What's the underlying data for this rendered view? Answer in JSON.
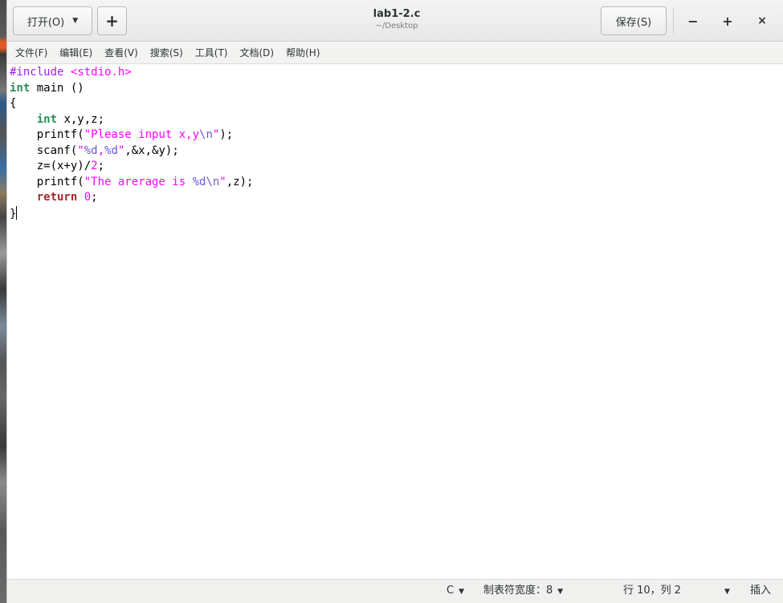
{
  "header": {
    "open_label": "打开(O)",
    "new_label": "+",
    "title": "lab1-2.c",
    "subtitle": "~/Desktop",
    "save_label": "保存(S)",
    "minimize": "−",
    "maximize": "+",
    "close": "×"
  },
  "menu": {
    "items": [
      {
        "label": "文件(F)"
      },
      {
        "label": "编辑(E)"
      },
      {
        "label": "查看(V)"
      },
      {
        "label": "搜索(S)"
      },
      {
        "label": "工具(T)"
      },
      {
        "label": "文档(D)"
      },
      {
        "label": "帮助(H)"
      }
    ]
  },
  "editor": {
    "language": "C",
    "lines": [
      "#include <stdio.h>",
      "int main ()",
      "{",
      "    int x,y,z;",
      "    printf(\"Please input x,y\\n\");",
      "    scanf(\"%d,%d\",&x,&y);",
      "    z=(x+y)/2;",
      "    printf(\"The arerage is %d\\n\",z);",
      "    return 0;",
      "}"
    ]
  },
  "status": {
    "language": "C",
    "tab_width": "制表符宽度：8",
    "position": "行 10，列 2",
    "mode": "插入"
  },
  "colors": {
    "preprocessor": "#a020f0",
    "string": "#ff00ff",
    "escape": "#6a5acd",
    "type": "#2e8b57",
    "keyword": "#a52a2a"
  }
}
